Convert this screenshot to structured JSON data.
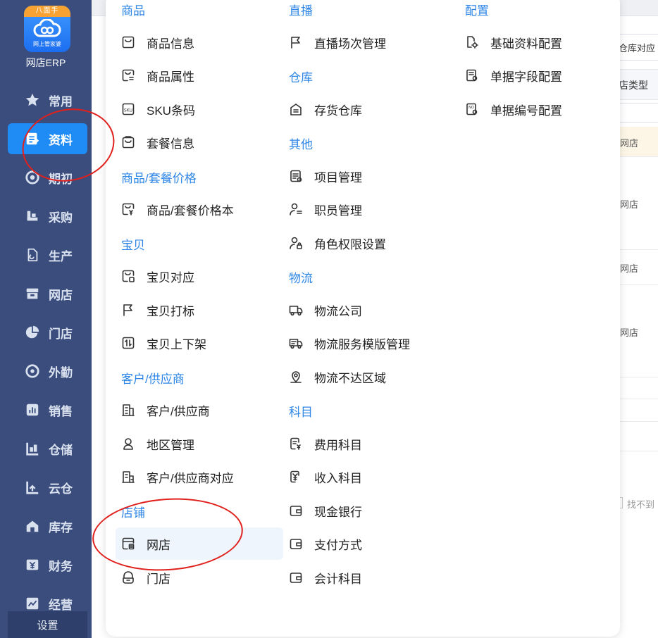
{
  "app": {
    "logo_ribbon": "八面手",
    "logo_sub": "网上管家婆",
    "name": "网店ERP",
    "settings": "设置"
  },
  "sidebar": {
    "items": [
      {
        "label": "常用",
        "icon": "star-icon"
      },
      {
        "label": "资料",
        "icon": "doc-icon",
        "active": true
      },
      {
        "label": "期初",
        "icon": "target-icon"
      },
      {
        "label": "采购",
        "icon": "cart-icon"
      },
      {
        "label": "生产",
        "icon": "production-icon"
      },
      {
        "label": "网店",
        "icon": "store-icon"
      },
      {
        "label": "门店",
        "icon": "pie-icon"
      },
      {
        "label": "外勤",
        "icon": "route-icon"
      },
      {
        "label": "销售",
        "icon": "bar-chart-icon"
      },
      {
        "label": "仓储",
        "icon": "warehouse-icon"
      },
      {
        "label": "云仓",
        "icon": "cloud-warehouse-icon"
      },
      {
        "label": "库存",
        "icon": "inventory-icon"
      },
      {
        "label": "财务",
        "icon": "finance-icon"
      },
      {
        "label": "经营",
        "icon": "trend-icon"
      }
    ]
  },
  "background": {
    "tab_partial": "仓库对应",
    "column_partial": "店类型",
    "cells": [
      "网店",
      "网店",
      "网店",
      "网店"
    ],
    "not_found": "找不到"
  },
  "menu": {
    "col1": [
      {
        "type": "title",
        "label": "商品"
      },
      {
        "type": "item",
        "label": "商品信息",
        "icon": "product-info-icon"
      },
      {
        "type": "item",
        "label": "商品属性",
        "icon": "product-attr-icon"
      },
      {
        "type": "item",
        "label": "SKU条码",
        "icon": "sku-icon"
      },
      {
        "type": "item",
        "label": "套餐信息",
        "icon": "package-icon"
      },
      {
        "type": "title",
        "label": "商品/套餐价格"
      },
      {
        "type": "item",
        "label": "商品/套餐价格本",
        "icon": "price-icon"
      },
      {
        "type": "title",
        "label": "宝贝"
      },
      {
        "type": "item",
        "label": "宝贝对应",
        "icon": "item-map-icon"
      },
      {
        "type": "item",
        "label": "宝贝打标",
        "icon": "flag-icon"
      },
      {
        "type": "item",
        "label": "宝贝上下架",
        "icon": "updown-icon"
      },
      {
        "type": "title",
        "label": "客户/供应商"
      },
      {
        "type": "item",
        "label": "客户/供应商",
        "icon": "building-icon"
      },
      {
        "type": "item",
        "label": "地区管理",
        "icon": "location-icon"
      },
      {
        "type": "item",
        "label": "客户/供应商对应",
        "icon": "building-map-icon"
      },
      {
        "type": "title",
        "label": "店铺"
      },
      {
        "type": "item",
        "label": "网店",
        "icon": "online-store-icon",
        "highlight": true
      },
      {
        "type": "item",
        "label": "门店",
        "icon": "shop-icon"
      }
    ],
    "col2": [
      {
        "type": "title",
        "label": "直播"
      },
      {
        "type": "item",
        "label": "直播场次管理",
        "icon": "live-flag-icon"
      },
      {
        "type": "title",
        "label": "仓库"
      },
      {
        "type": "item",
        "label": "存货仓库",
        "icon": "warehouse-home-icon"
      },
      {
        "type": "title",
        "label": "其他"
      },
      {
        "type": "item",
        "label": "项目管理",
        "icon": "project-icon"
      },
      {
        "type": "item",
        "label": "职员管理",
        "icon": "staff-icon"
      },
      {
        "type": "item",
        "label": "角色权限设置",
        "icon": "role-lock-icon"
      },
      {
        "type": "title",
        "label": "物流"
      },
      {
        "type": "item",
        "label": "物流公司",
        "icon": "truck-icon"
      },
      {
        "type": "item",
        "label": "物流服务模版管理",
        "icon": "truck-template-icon"
      },
      {
        "type": "item",
        "label": "物流不达区域",
        "icon": "no-area-icon"
      },
      {
        "type": "title",
        "label": "科目"
      },
      {
        "type": "item",
        "label": "费用科目",
        "icon": "expense-icon"
      },
      {
        "type": "item",
        "label": "收入科目",
        "icon": "income-icon"
      },
      {
        "type": "item",
        "label": "现金银行",
        "icon": "wallet-icon"
      },
      {
        "type": "item",
        "label": "支付方式",
        "icon": "payment-icon"
      },
      {
        "type": "item",
        "label": "会计科目",
        "icon": "accounting-icon"
      }
    ],
    "col3": [
      {
        "type": "title",
        "label": "配置"
      },
      {
        "type": "item",
        "label": "基础资料配置",
        "icon": "config-icon"
      },
      {
        "type": "item",
        "label": "单据字段配置",
        "icon": "field-config-icon"
      },
      {
        "type": "item",
        "label": "单据编号配置",
        "icon": "number-config-icon"
      }
    ]
  },
  "colors": {
    "sidebar_bg": "#3a4d7d",
    "active_nav": "#1f8bf5",
    "section_title": "#2e86e6",
    "annotation": "#e0201c"
  }
}
